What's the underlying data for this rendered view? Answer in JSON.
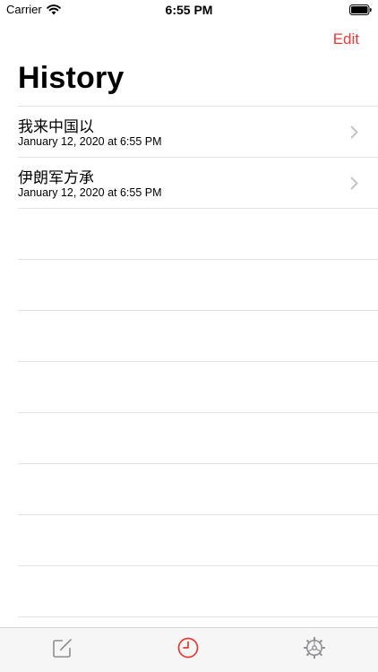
{
  "status_bar": {
    "carrier": "Carrier",
    "time": "6:55 PM"
  },
  "nav": {
    "edit_label": "Edit"
  },
  "page": {
    "title": "History"
  },
  "history": [
    {
      "title": "我来中国以",
      "date": "January 12, 2020 at 6:55 PM"
    },
    {
      "title": "伊朗军方承",
      "date": "January 12, 2020 at 6:55 PM"
    }
  ],
  "colors": {
    "accent": "#e33b36",
    "separator": "#e2e2e4",
    "inactive_icon": "#8e8e93"
  },
  "tabs": [
    {
      "icon": "compose-icon",
      "active": false
    },
    {
      "icon": "clock-icon",
      "active": true
    },
    {
      "icon": "gear-icon",
      "active": false
    }
  ]
}
